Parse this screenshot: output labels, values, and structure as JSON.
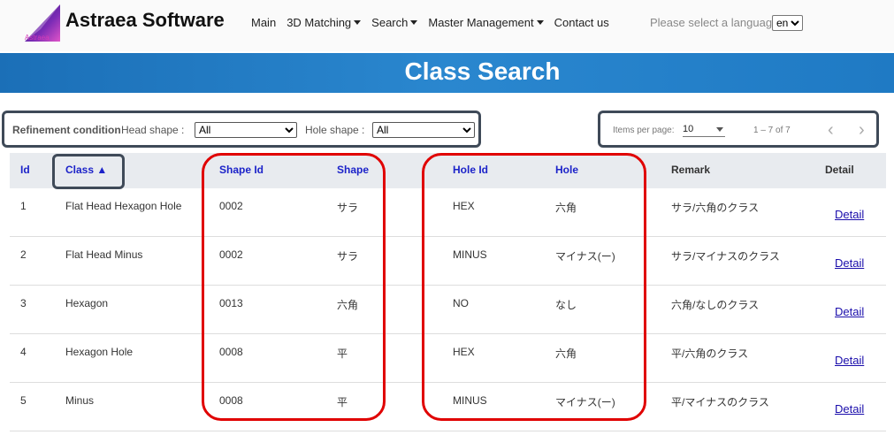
{
  "brand": {
    "name": "Astraea Software",
    "logo_text": "Astraea"
  },
  "nav": {
    "items": [
      {
        "label": "Main",
        "dropdown": false
      },
      {
        "label": "3D Matching",
        "dropdown": true
      },
      {
        "label": "Search",
        "dropdown": true
      },
      {
        "label": "Master Management",
        "dropdown": true
      },
      {
        "label": "Contact us",
        "dropdown": false
      }
    ],
    "language_prompt": "Please select a language.",
    "language_value": "en"
  },
  "page": {
    "title": "Class Search"
  },
  "filter": {
    "title": "Refinement condition",
    "head_shape_label": "Head shape :",
    "head_shape_value": "All",
    "hole_shape_label": "Hole shape :",
    "hole_shape_value": "All"
  },
  "pager": {
    "items_per_page_label": "Items per page:",
    "items_per_page_value": "10",
    "range": "1 – 7 of 7",
    "prev_symbol": "‹",
    "next_symbol": "›"
  },
  "table": {
    "headers": {
      "id": "Id",
      "class": "Class ▲",
      "shape_id": "Shape Id",
      "shape": "Shape",
      "hole_id": "Hole Id",
      "hole": "Hole",
      "remark": "Remark",
      "detail": "Detail"
    },
    "rows": [
      {
        "id": "1",
        "class": "Flat Head Hexagon Hole",
        "shape_id": "0002",
        "shape": "サラ",
        "hole_id": "HEX",
        "hole": "六角",
        "remark": "サラ/六角のクラス",
        "detail": "Detail"
      },
      {
        "id": "2",
        "class": "Flat Head Minus",
        "shape_id": "0002",
        "shape": "サラ",
        "hole_id": "MINUS",
        "hole": "マイナス(ー)",
        "remark": "サラ/マイナスのクラス",
        "detail": "Detail"
      },
      {
        "id": "3",
        "class": "Hexagon",
        "shape_id": "0013",
        "shape": "六角",
        "hole_id": "NO",
        "hole": "なし",
        "remark": "六角/なしのクラス",
        "detail": "Detail"
      },
      {
        "id": "4",
        "class": "Hexagon Hole",
        "shape_id": "0008",
        "shape": "平",
        "hole_id": "HEX",
        "hole": "六角",
        "remark": "平/六角のクラス",
        "detail": "Detail"
      },
      {
        "id": "5",
        "class": "Minus",
        "shape_id": "0008",
        "shape": "平",
        "hole_id": "MINUS",
        "hole": "マイナス(ー)",
        "remark": "平/マイナスのクラス",
        "detail": "Detail"
      }
    ]
  },
  "colors": {
    "banner": "#1f7ac4",
    "header_link": "#1c23c9",
    "highlight_red": "#e00000",
    "highlight_dark": "#3f4a58"
  }
}
